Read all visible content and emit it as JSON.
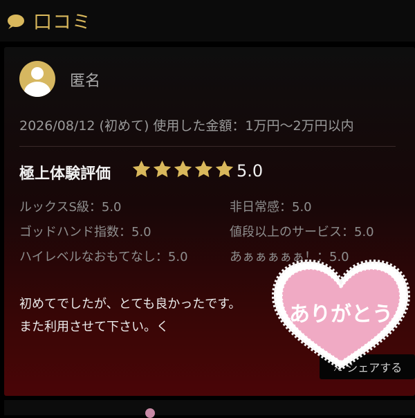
{
  "header": {
    "title": "口コミ",
    "icon": "speech-bubble-icon",
    "accent": "#d9b85c"
  },
  "review": {
    "username": "匿名",
    "meta": "2026/08/12 (初めて) 使用した金額：1万円〜2万円以内",
    "rating_title": "極上体験評価",
    "stars": 5,
    "score": "5.0",
    "criteria": [
      "ルックスS級：5.0",
      "非日常感：5.0",
      "ゴッドハンド指数：5.0",
      "値段以上のサービス：5.0",
      "ハイレベルなおもてなし：5.0",
      "あぁぁぁぁぁ！：5.0"
    ],
    "comment_lines": [
      "初めてでしたが、とても良かったです。",
      "また利用させて下さい。く"
    ]
  },
  "share": {
    "label": "シェアする",
    "icon": "x-logo-icon"
  },
  "sticker": {
    "text": "ありがとう",
    "color": "#f0aac4"
  }
}
